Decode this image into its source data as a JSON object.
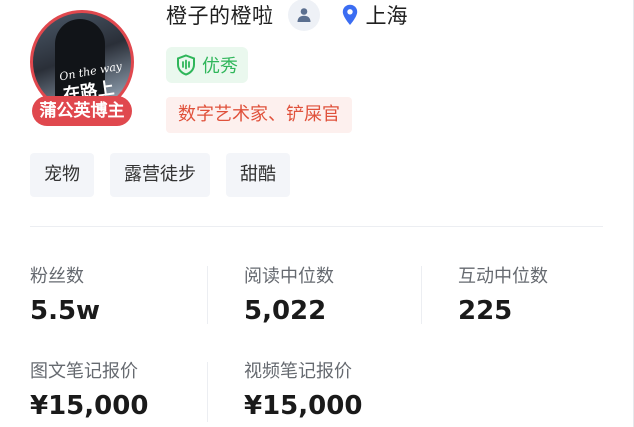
{
  "profile": {
    "name": "橙子的橙啦",
    "location": "上海",
    "avatar_badge": "蒲公英博主",
    "avatar_text_en": "On the way",
    "avatar_text_cn": "在路上",
    "quality": "优秀",
    "role": "数字艺术家、铲屎官"
  },
  "tags": [
    "宠物",
    "露营徒步",
    "甜酷"
  ],
  "stats": {
    "followers": {
      "label": "粉丝数",
      "value": "5.5w"
    },
    "median_reads": {
      "label": "阅读中位数",
      "value": "5,022"
    },
    "median_interactions": {
      "label": "互动中位数",
      "value": "225"
    },
    "image_note_price": {
      "label": "图文笔记报价",
      "value": "¥15,000"
    },
    "video_note_price": {
      "label": "视频笔记报价",
      "value": "¥15,000"
    }
  },
  "colors": {
    "avatar_ring": "#e0484e",
    "quality_green": "#2fb65a",
    "role_red": "#e0523c",
    "location_blue": "#3b6df2"
  },
  "icons": {
    "user": "user-icon",
    "location": "location-pin-icon",
    "quality": "shield-check-icon"
  }
}
